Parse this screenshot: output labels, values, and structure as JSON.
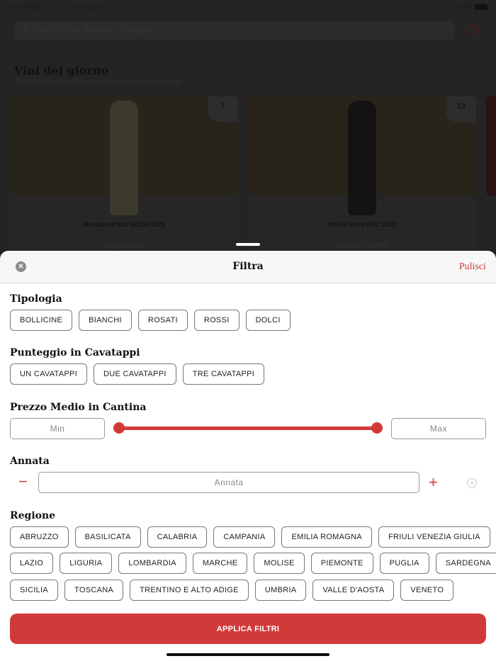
{
  "status": {
    "back_app": "◂ TestFlight",
    "time": "17:21",
    "date": "Sab 28 set",
    "wifi": "wifi-icon",
    "battery": "98%"
  },
  "search": {
    "placeholder": "Cerca Vino, Azienda, Vitigno"
  },
  "section": {
    "title": "Vini del giorno",
    "subtitle": "Scopri i vini che abbiamo selezionato per te oggi"
  },
  "cards": [
    {
      "badge": "7",
      "name": "Moscato d'Asti DOCG 2023",
      "producer": "Ghiga Enrico"
    },
    {
      "badge": "13",
      "name": "Sicilia Grillo DOC 2022",
      "producer": "Catalano Viticoltori"
    }
  ],
  "sheet": {
    "title": "Filtra",
    "clear": "Pulisci",
    "tipologia": {
      "label": "Tipologia",
      "options": [
        "BOLLICINE",
        "BIANCHI",
        "ROSATI",
        "ROSSI",
        "DOLCI"
      ]
    },
    "punteggio": {
      "label": "Punteggio in Cavatappi",
      "options": [
        "UN CAVATAPPI",
        "DUE CAVATAPPI",
        "TRE CAVATAPPI"
      ]
    },
    "prezzo": {
      "label": "Prezzo Medio in Cantina",
      "min_placeholder": "Min",
      "max_placeholder": "Max",
      "range_low": 0,
      "range_high": 1
    },
    "annata": {
      "label": "Annata",
      "placeholder": "Annata",
      "minus": "−",
      "plus": "+",
      "clear": "×"
    },
    "regione": {
      "label": "Regione",
      "rows": [
        [
          "ABRUZZO",
          "BASILICATA",
          "CALABRIA",
          "CAMPANIA",
          "EMILIA ROMAGNA",
          "FRIULI VENEZIA GIULIA"
        ],
        [
          "LAZIO",
          "LIGURIA",
          "LOMBARDIA",
          "MARCHE",
          "MOLISE",
          "PIEMONTE",
          "PUGLIA",
          "SARDEGNA"
        ],
        [
          "SICILIA",
          "TOSCANA",
          "TRENTINO E ALTO ADIGE",
          "UMBRIA",
          "VALLE D'AOSTA",
          "VENETO"
        ]
      ]
    },
    "apply": "APPLICA FILTRI"
  },
  "colors": {
    "accent": "#d23a3a"
  }
}
